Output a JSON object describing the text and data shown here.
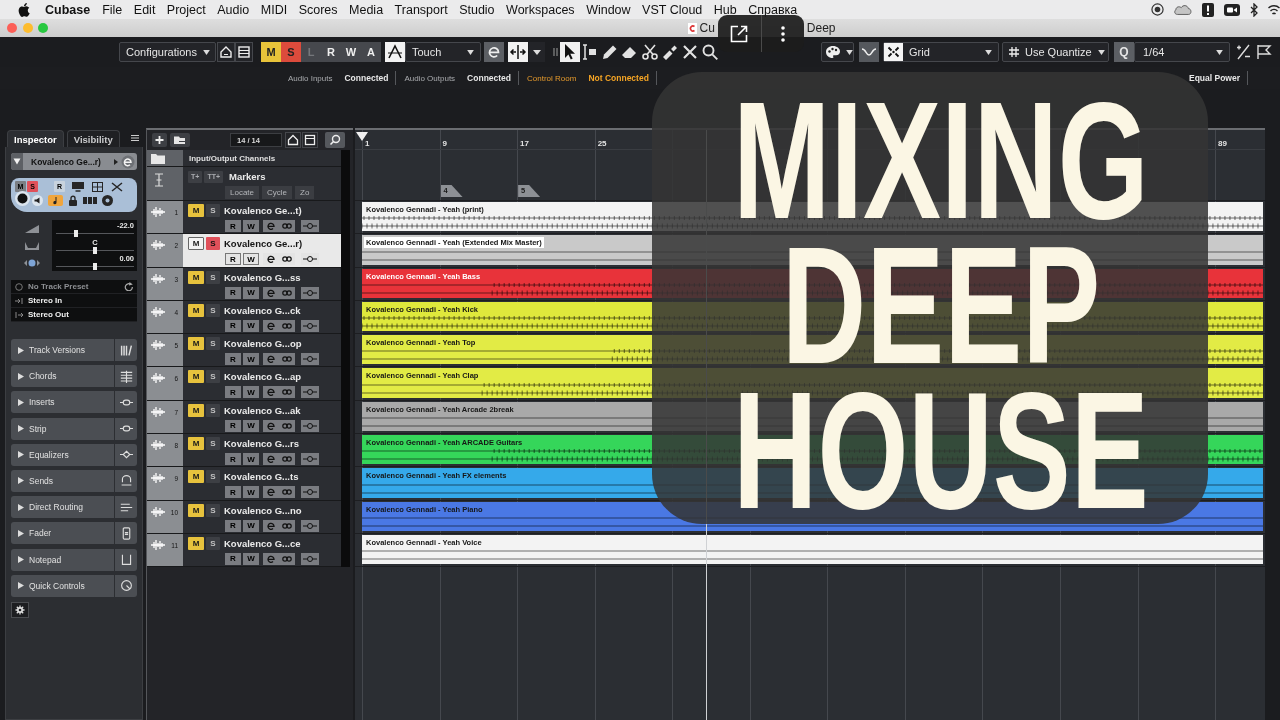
{
  "menubar": {
    "app": "Cubase",
    "menus": [
      "File",
      "Edit",
      "Project",
      "Audio",
      "MIDI",
      "Scores",
      "Media",
      "Transport",
      "Studio",
      "Workspaces",
      "Window",
      "VST Cloud",
      "Hub",
      "Справка"
    ]
  },
  "window": {
    "title_start": "Cu",
    "title_end": "Deep"
  },
  "toolbar": {
    "configurations": "Configurations",
    "global_buttons": [
      {
        "label": "M",
        "kind": "mute",
        "on": true,
        "disabled": false
      },
      {
        "label": "S",
        "kind": "solo",
        "on": true,
        "disabled": false
      },
      {
        "label": "L",
        "kind": "listen",
        "on": false,
        "disabled": true
      },
      {
        "label": "R",
        "kind": "read",
        "on": false,
        "disabled": false
      },
      {
        "label": "W",
        "kind": "write",
        "on": false,
        "disabled": false
      },
      {
        "label": "A",
        "kind": "all",
        "on": false,
        "disabled": false
      }
    ],
    "automation_mode": "Touch",
    "tools": [
      {
        "kind": "object-select",
        "selected": true
      },
      {
        "kind": "range",
        "selected": false
      },
      {
        "kind": "draw",
        "selected": false
      },
      {
        "kind": "erase",
        "selected": false
      },
      {
        "kind": "split",
        "selected": false
      },
      {
        "kind": "glue",
        "selected": false
      },
      {
        "kind": "mute",
        "selected": false
      },
      {
        "kind": "zoom",
        "selected": false
      }
    ],
    "snap_type": "Grid",
    "grid_type": "Use Quantize",
    "quantize_button": "Q",
    "quantize": "1/64"
  },
  "status": {
    "items": [
      {
        "label": "Audio Inputs",
        "value": "Connected",
        "warning": false
      },
      {
        "label": "Audio Outputs",
        "value": "Connected",
        "warning": false
      },
      {
        "label": "Control Room",
        "value": "Not Connected",
        "warning": true
      }
    ],
    "pan_law": "Equal Power"
  },
  "inspector": {
    "tabs": [
      {
        "label": "Inspector",
        "selected": true
      },
      {
        "label": "Visibility",
        "selected": false
      }
    ],
    "track_name": "Kovalenco Ge...r)",
    "mute_label": "M",
    "solo_label": "S",
    "read_label": "R",
    "muted": false,
    "solo": true,
    "musical_time": true,
    "volume": {
      "reading": "-22.0",
      "level": 0.25
    },
    "pan": {
      "reading": "C",
      "level": 0.5
    },
    "delay": {
      "reading": "0.00",
      "level": 0.5
    },
    "preset": "No Track Preset",
    "input": "Stereo In",
    "output": "Stereo Out",
    "sections": [
      {
        "label": "Track Versions",
        "kind": "versions",
        "expanded": false
      },
      {
        "label": "Chords",
        "kind": "chords",
        "expanded": false
      },
      {
        "label": "Inserts",
        "kind": "inserts",
        "expanded": false
      },
      {
        "label": "Strip",
        "kind": "strip",
        "expanded": false
      },
      {
        "label": "Equalizers",
        "kind": "eq",
        "expanded": false
      },
      {
        "label": "Sends",
        "kind": "sends",
        "expanded": false
      },
      {
        "label": "Direct Routing",
        "kind": "routing",
        "expanded": false
      },
      {
        "label": "Fader",
        "kind": "fader",
        "expanded": false
      },
      {
        "label": "Notepad",
        "kind": "notepad",
        "expanded": false
      },
      {
        "label": "Quick Controls",
        "kind": "quick",
        "expanded": false
      }
    ]
  },
  "track_list": {
    "track_count": "14 / 14",
    "folder_track": "Input/Output Channels",
    "marker_track": {
      "name": "Markers",
      "tool_labels": [
        "T+",
        "TT+"
      ],
      "buttons": [
        "Locate",
        "Cycle",
        "Zo"
      ]
    },
    "tracks": [
      {
        "number": "1",
        "name": "Kovalenco Ge...t)",
        "mute_label": "M",
        "solo_label": "S",
        "read_label": "R",
        "write_label": "W",
        "muted": true,
        "solo": false,
        "selected": false
      },
      {
        "number": "2",
        "name": "Kovalenco Ge...r)",
        "mute_label": "M",
        "solo_label": "S",
        "read_label": "R",
        "write_label": "W",
        "muted": false,
        "solo": true,
        "selected": true
      },
      {
        "number": "3",
        "name": "Kovalenco G...ss",
        "mute_label": "M",
        "solo_label": "S",
        "read_label": "R",
        "write_label": "W",
        "muted": true,
        "solo": false,
        "selected": false
      },
      {
        "number": "4",
        "name": "Kovalenco G...ck",
        "mute_label": "M",
        "solo_label": "S",
        "read_label": "R",
        "write_label": "W",
        "muted": true,
        "solo": false,
        "selected": false
      },
      {
        "number": "5",
        "name": "Kovalenco G...op",
        "mute_label": "M",
        "solo_label": "S",
        "read_label": "R",
        "write_label": "W",
        "muted": true,
        "solo": false,
        "selected": false
      },
      {
        "number": "6",
        "name": "Kovalenco G...ap",
        "mute_label": "M",
        "solo_label": "S",
        "read_label": "R",
        "write_label": "W",
        "muted": true,
        "solo": false,
        "selected": false
      },
      {
        "number": "7",
        "name": "Kovalenco G...ak",
        "mute_label": "M",
        "solo_label": "S",
        "read_label": "R",
        "write_label": "W",
        "muted": true,
        "solo": false,
        "selected": false
      },
      {
        "number": "8",
        "name": "Kovalenco G...rs",
        "mute_label": "M",
        "solo_label": "S",
        "read_label": "R",
        "write_label": "W",
        "muted": true,
        "solo": false,
        "selected": false
      },
      {
        "number": "9",
        "name": "Kovalenco G...ts",
        "mute_label": "M",
        "solo_label": "S",
        "read_label": "R",
        "write_label": "W",
        "muted": true,
        "solo": false,
        "selected": false
      },
      {
        "number": "10",
        "name": "Kovalenco G...no",
        "mute_label": "M",
        "solo_label": "S",
        "read_label": "R",
        "write_label": "W",
        "muted": true,
        "solo": false,
        "selected": false
      },
      {
        "number": "11",
        "name": "Kovalenco G...ce",
        "mute_label": "M",
        "solo_label": "S",
        "read_label": "R",
        "write_label": "W",
        "muted": true,
        "solo": false,
        "selected": false
      }
    ]
  },
  "arrangement": {
    "ruler_start": [
      "1",
      "9",
      "17",
      "25"
    ],
    "ruler_end": [
      "89"
    ],
    "markers": [
      "4",
      "5"
    ],
    "clips": [
      {
        "name": "Kovalenco Gennadi - Yeah (print)",
        "color": "#f3f3f3"
      },
      {
        "name": "Kovalenco Gennadi - Yeah (Extended Mix Master)",
        "color": "#c9c9c9"
      },
      {
        "name": "Kovalenco Gennadi - Yeah Bass",
        "color": "#e8333a"
      },
      {
        "name": "Kovalenco Gennadi - Yeah Kick",
        "color": "#dfe83c"
      },
      {
        "name": "Kovalenco Gennadi - Yeah Top",
        "color": "#e2eb45"
      },
      {
        "name": "Kovalenco Gennadi - Yeah Clap",
        "color": "#e2eb45"
      },
      {
        "name": "Kovalenco Gennadi - Yeah Arcade 2break",
        "color": "#a9a9a9"
      },
      {
        "name": "Kovalenco Gennadi - Yeah ARCADE Guitars",
        "color": "#35d65a"
      },
      {
        "name": "Kovalenco Gennadi - Yeah FX elements",
        "color": "#35a9ea"
      },
      {
        "name": "Kovalenco Gennadi - Yeah Piano",
        "color": "#4a78e4"
      },
      {
        "name": "Kovalenco Gennadi - Yeah Voice",
        "color": "#f3f3f3"
      }
    ]
  },
  "overlay": {
    "headline": "MIXING DEEP HOUSE"
  }
}
